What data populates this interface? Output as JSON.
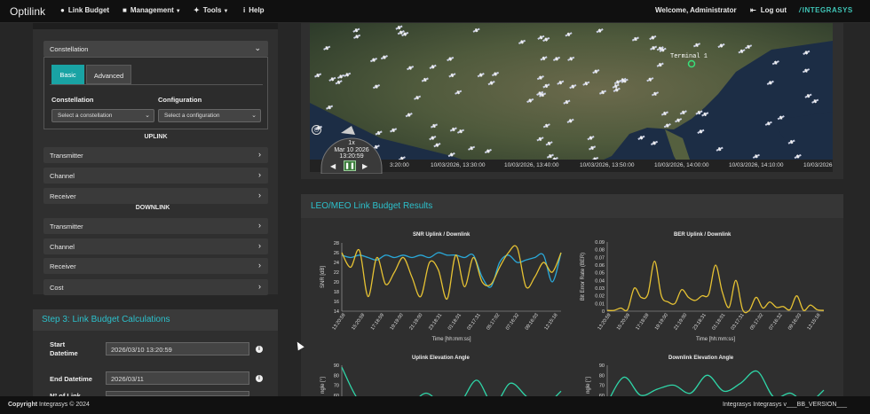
{
  "nav": {
    "brand": "Optilink",
    "items": [
      {
        "label": "Link Budget",
        "icon": "globe-icon",
        "caret": false
      },
      {
        "label": "Management",
        "icon": "lock-icon",
        "caret": true
      },
      {
        "label": "Tools",
        "icon": "wrench-icon",
        "caret": true
      },
      {
        "label": "Help",
        "icon": "info-icon",
        "caret": false
      }
    ],
    "welcome": "Welcome, Administrator",
    "logout": "Log out",
    "logo": "INTEGRASYS"
  },
  "left": {
    "constellation_header": "Constellation",
    "tabs": [
      "Basic",
      "Advanced"
    ],
    "constellation_label": "Constellation",
    "constellation_placeholder": "Select a constellation",
    "configuration_label": "Configuration",
    "configuration_placeholder": "Select a configuration",
    "uplink": "UPLINK",
    "uplink_items": [
      "Transmitter",
      "Channel",
      "Receiver"
    ],
    "downlink": "DOWNLINK",
    "downlink_items": [
      "Transmitter",
      "Channel",
      "Receiver",
      "Cost"
    ]
  },
  "step3": {
    "title": "Step 3: Link Budget Calculations",
    "start_label_1": "Start",
    "start_label_2": "Datetime",
    "start_value": "2026/03/10 13:20:59",
    "end_label": "End Datetime",
    "end_value": "2026/03/11",
    "nlink_label": "Nº of Link"
  },
  "map": {
    "terminal": "Terminal 1",
    "clock_speed": "1x",
    "clock_date": "Mar 10 2026",
    "clock_time": "13:20:59",
    "timeline": [
      "3:20:00",
      "10/03/2026, 13:30:00",
      "10/03/2026, 13:40:00",
      "10/03/2026, 13:50:00",
      "10/03/2026, 14:00:00",
      "10/03/2026, 14:10:00",
      "10/03/2026"
    ]
  },
  "results": {
    "title": "LEO/MEO Link Budget Results"
  },
  "chart_data": [
    {
      "type": "line",
      "title": "SNR Uplink / Downlink",
      "xlabel": "Time [hh:mm:ss]",
      "ylabel": "SNR [dB]",
      "ylim": [
        14,
        28
      ],
      "yticks": [
        14,
        16,
        18,
        20,
        22,
        24,
        26,
        28
      ],
      "x": [
        "13:20:59",
        "15:20:59",
        "17:18:59",
        "19:19:00",
        "21:19:00",
        "23:18:31",
        "01:18:01",
        "03:17:31",
        "05:17:02",
        "07:16:32",
        "09:16:03",
        "12:15:18"
      ],
      "series": [
        {
          "color": "#2aa8d8",
          "values": [
            25.5,
            25,
            25.5,
            25,
            24.5,
            25.5,
            25,
            25.5,
            25,
            25.5,
            25,
            26,
            25.5,
            25.5,
            25,
            25.5,
            21,
            19,
            24,
            25.5,
            24,
            24.5,
            25,
            25.5,
            20,
            26
          ]
        },
        {
          "color": "#e6c233",
          "values": [
            26,
            23,
            26.5,
            17,
            25,
            19.5,
            22,
            25,
            21,
            17,
            24,
            22.5,
            16.5,
            25.5,
            19,
            25,
            20,
            19.5,
            23,
            26,
            27,
            19,
            21,
            24,
            22,
            26
          ]
        }
      ]
    },
    {
      "type": "line",
      "title": "BER Uplink / Downlink",
      "xlabel": "Time [hh:mm:ss]",
      "ylabel": "Bit Error Rate (BER)",
      "ylim": [
        0,
        0.09
      ],
      "yticks": [
        0,
        0.01,
        0.02,
        0.03,
        0.04,
        0.05,
        0.06,
        0.07,
        0.08,
        0.09
      ],
      "x": [
        "13:20:59",
        "15:20:59",
        "17:18:59",
        "19:19:00",
        "21:19:00",
        "23:18:31",
        "01:18:01",
        "03:17:31",
        "05:17:02",
        "07:16:32",
        "09:16:03",
        "12:15:18"
      ],
      "series": [
        {
          "color": "#e6c233",
          "values": [
            0.001,
            0.001,
            0.004,
            0.002,
            0.03,
            0.018,
            0.022,
            0.065,
            0.02,
            0.012,
            0.01,
            0.028,
            0.018,
            0.014,
            0.02,
            0.022,
            0.06,
            0.025,
            0.005,
            0.04,
            0.002,
            0.001,
            0.018,
            0.004,
            0.012,
            0.005,
            0.006,
            0.002,
            0.02,
            0.001,
            0.008,
            0.002,
            0.001
          ]
        }
      ]
    },
    {
      "type": "line",
      "title": "Uplink Elevation Angle",
      "ylabel": "ngle [°]",
      "ylim": [
        50,
        90
      ],
      "yticks": [
        90,
        80,
        70,
        60
      ],
      "series": [
        {
          "color": "#2fd6a8",
          "values": [
            88,
            55,
            50,
            52,
            50,
            62,
            50,
            52,
            75,
            50,
            72,
            58,
            50,
            64
          ]
        }
      ]
    },
    {
      "type": "line",
      "title": "Downlink Elevation Angle",
      "ylabel": "ngle [°]",
      "ylim": [
        50,
        90
      ],
      "yticks": [
        90,
        80,
        70,
        60
      ],
      "series": [
        {
          "color": "#2fd6a8",
          "values": [
            52,
            78,
            60,
            66,
            70,
            62,
            80,
            64,
            72,
            84,
            58,
            62,
            52,
            65
          ]
        }
      ]
    }
  ],
  "footer": {
    "copy_bold": "Copyright",
    "copy_rest": "Integrasys © 2024",
    "version": "Integrasys Integrasys v___BB_VERSION___"
  }
}
